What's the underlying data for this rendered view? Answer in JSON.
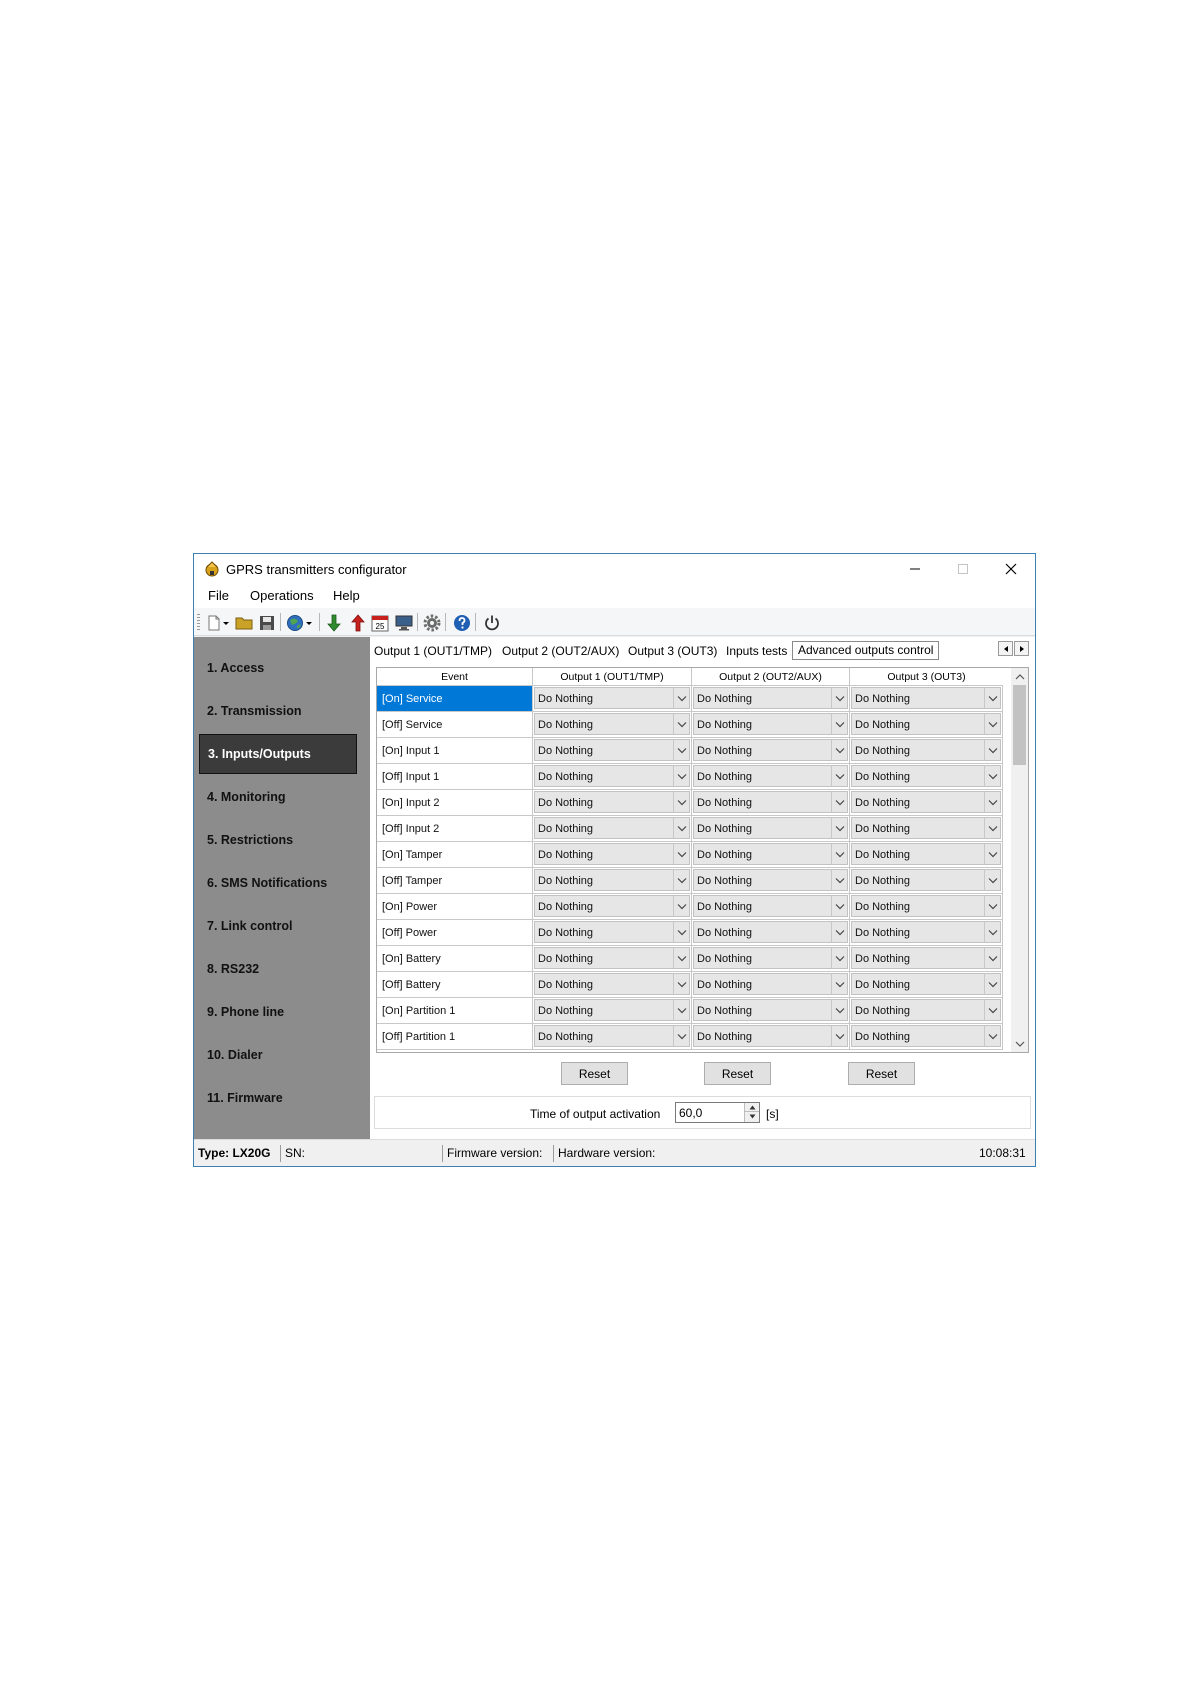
{
  "window": {
    "title": "GPRS transmitters configurator"
  },
  "menu": {
    "items": [
      "File",
      "Operations",
      "Help"
    ]
  },
  "toolbar": {
    "icons": [
      "new-document-icon",
      "open-folder-icon",
      "save-disk-icon",
      "globe-icon",
      "download-arrow-icon",
      "upload-arrow-icon",
      "calendar-icon",
      "monitor-icon",
      "gear-icon",
      "help-icon",
      "power-icon"
    ],
    "calendar_day": "25"
  },
  "sidebar": {
    "items": [
      {
        "label": "1. Access"
      },
      {
        "label": "2. Transmission"
      },
      {
        "label": "3. Inputs/Outputs",
        "active": true
      },
      {
        "label": "4. Monitoring"
      },
      {
        "label": "5. Restrictions"
      },
      {
        "label": "6. SMS Notifications"
      },
      {
        "label": "7. Link control"
      },
      {
        "label": "8. RS232"
      },
      {
        "label": "9. Phone line"
      },
      {
        "label": "10. Dialer"
      },
      {
        "label": "11. Firmware"
      }
    ]
  },
  "tabs": [
    {
      "label": "Output 1 (OUT1/TMP)"
    },
    {
      "label": "Output 2 (OUT2/AUX)"
    },
    {
      "label": "Output 3 (OUT3)"
    },
    {
      "label": "Inputs tests"
    },
    {
      "label": "Advanced outputs control",
      "active": true
    }
  ],
  "grid": {
    "headers": [
      "Event",
      "Output 1 (OUT1/TMP)",
      "Output 2 (OUT2/AUX)",
      "Output 3 (OUT3)"
    ],
    "rows": [
      {
        "event": "[On] Service",
        "out1": "Do Nothing",
        "out2": "Do Nothing",
        "out3": "Do Nothing"
      },
      {
        "event": "[Off] Service",
        "out1": "Do Nothing",
        "out2": "Do Nothing",
        "out3": "Do Nothing"
      },
      {
        "event": "[On] Input 1",
        "out1": "Do Nothing",
        "out2": "Do Nothing",
        "out3": "Do Nothing"
      },
      {
        "event": "[Off] Input 1",
        "out1": "Do Nothing",
        "out2": "Do Nothing",
        "out3": "Do Nothing"
      },
      {
        "event": "[On] Input 2",
        "out1": "Do Nothing",
        "out2": "Do Nothing",
        "out3": "Do Nothing"
      },
      {
        "event": "[Off] Input 2",
        "out1": "Do Nothing",
        "out2": "Do Nothing",
        "out3": "Do Nothing"
      },
      {
        "event": "[On] Tamper",
        "out1": "Do Nothing",
        "out2": "Do Nothing",
        "out3": "Do Nothing"
      },
      {
        "event": "[Off] Tamper",
        "out1": "Do Nothing",
        "out2": "Do Nothing",
        "out3": "Do Nothing"
      },
      {
        "event": "[On] Power",
        "out1": "Do Nothing",
        "out2": "Do Nothing",
        "out3": "Do Nothing"
      },
      {
        "event": "[Off] Power",
        "out1": "Do Nothing",
        "out2": "Do Nothing",
        "out3": "Do Nothing"
      },
      {
        "event": "[On] Battery",
        "out1": "Do Nothing",
        "out2": "Do Nothing",
        "out3": "Do Nothing"
      },
      {
        "event": "[Off] Battery",
        "out1": "Do Nothing",
        "out2": "Do Nothing",
        "out3": "Do Nothing"
      },
      {
        "event": "[On] Partition 1",
        "out1": "Do Nothing",
        "out2": "Do Nothing",
        "out3": "Do Nothing"
      },
      {
        "event": "[Off] Partition 1",
        "out1": "Do Nothing",
        "out2": "Do Nothing",
        "out3": "Do Nothing"
      }
    ],
    "selected_row": 0
  },
  "buttons": {
    "reset": "Reset"
  },
  "time_activation": {
    "label": "Time of output activation",
    "value": "60,0",
    "unit": "[s]"
  },
  "status": {
    "type": "Type: LX20G",
    "sn": "SN:",
    "firmware": "Firmware version:",
    "hardware": "Hardware version:",
    "time": "10:08:31"
  },
  "colors": {
    "selection": "#0078d7",
    "sidebar_bg": "#8c8c8c",
    "sidebar_active": "#3b3b3b",
    "window_border": "#3c7fb1"
  }
}
